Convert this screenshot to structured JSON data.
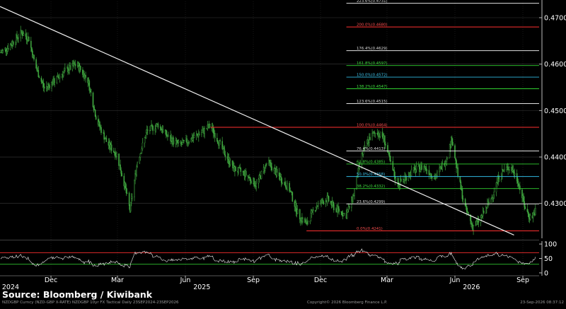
{
  "chart_data": [
    {
      "type": "candlestick",
      "ylim": [
        0.4225,
        0.4735
      ],
      "ytick_labels": [
        "0.4700",
        "0.4600",
        "0.4500",
        "0.4400",
        "0.4300"
      ],
      "ytick_values": [
        0.47,
        0.46,
        0.45,
        0.44,
        0.43
      ],
      "xlim": [
        "2024-09-23",
        "2026-09-23"
      ],
      "x_month_labels": [
        {
          "label": "Dec",
          "date": "2024-12-01"
        },
        {
          "label": "Mar",
          "date": "2025-03-01"
        },
        {
          "label": "Jun",
          "date": "2025-06-01"
        },
        {
          "label": "Sep",
          "date": "2025-09-01"
        },
        {
          "label": "Dec",
          "date": "2025-12-01"
        },
        {
          "label": "Mar",
          "date": "2026-03-01"
        },
        {
          "label": "Jun",
          "date": "2026-06-01"
        },
        {
          "label": "Sep",
          "date": "2026-09-01"
        }
      ],
      "x_year_labels": [
        {
          "label": "2024",
          "date": "2024-10-15"
        },
        {
          "label": "2025",
          "date": "2025-07-01"
        },
        {
          "label": "2026",
          "date": "2026-07-01"
        }
      ],
      "price_path": [
        [
          "2024-09-24",
          0.4625
        ],
        [
          "2024-10-05",
          0.4638
        ],
        [
          "2024-10-15",
          0.4655
        ],
        [
          "2024-10-22",
          0.4668
        ],
        [
          "2024-11-01",
          0.4655
        ],
        [
          "2024-11-10",
          0.4595
        ],
        [
          "2024-11-22",
          0.4548
        ],
        [
          "2024-12-05",
          0.4562
        ],
        [
          "2024-12-20",
          0.4585
        ],
        [
          "2025-01-05",
          0.46
        ],
        [
          "2025-01-20",
          0.4565
        ],
        [
          "2025-02-01",
          0.448
        ],
        [
          "2025-02-15",
          0.443
        ],
        [
          "2025-02-28",
          0.4405
        ],
        [
          "2025-03-10",
          0.4345
        ],
        [
          "2025-03-18",
          0.4285
        ],
        [
          "2025-03-28",
          0.439
        ],
        [
          "2025-04-10",
          0.4455
        ],
        [
          "2025-04-25",
          0.447
        ],
        [
          "2025-05-10",
          0.444
        ],
        [
          "2025-05-25",
          0.4425
        ],
        [
          "2025-06-10",
          0.444
        ],
        [
          "2025-06-25",
          0.4455
        ],
        [
          "2025-07-05",
          0.4468
        ],
        [
          "2025-07-20",
          0.442
        ],
        [
          "2025-08-05",
          0.4375
        ],
        [
          "2025-08-20",
          0.4365
        ],
        [
          "2025-09-05",
          0.434
        ],
        [
          "2025-09-20",
          0.439
        ],
        [
          "2025-10-05",
          0.436
        ],
        [
          "2025-10-20",
          0.433
        ],
        [
          "2025-11-01",
          0.4275
        ],
        [
          "2025-11-12",
          0.4255
        ],
        [
          "2025-11-25",
          0.4295
        ],
        [
          "2025-12-10",
          0.431
        ],
        [
          "2025-12-20",
          0.429
        ],
        [
          "2026-01-05",
          0.4275
        ],
        [
          "2026-01-15",
          0.432
        ],
        [
          "2026-01-25",
          0.44
        ],
        [
          "2026-02-05",
          0.444
        ],
        [
          "2026-02-15",
          0.4455
        ],
        [
          "2026-02-25",
          0.444
        ],
        [
          "2026-03-05",
          0.439
        ],
        [
          "2026-03-15",
          0.434
        ],
        [
          "2026-03-25",
          0.4355
        ],
        [
          "2026-04-05",
          0.437
        ],
        [
          "2026-04-20",
          0.438
        ],
        [
          "2026-05-05",
          0.4355
        ],
        [
          "2026-05-20",
          0.4395
        ],
        [
          "2026-05-28",
          0.444
        ],
        [
          "2026-06-05",
          0.436
        ],
        [
          "2026-06-15",
          0.429
        ],
        [
          "2026-06-25",
          0.425
        ],
        [
          "2026-07-05",
          0.4265
        ],
        [
          "2026-07-20",
          0.431
        ],
        [
          "2026-08-01",
          0.4365
        ],
        [
          "2026-08-15",
          0.438
        ],
        [
          "2026-08-25",
          0.435
        ],
        [
          "2026-09-05",
          0.4285
        ],
        [
          "2026-09-12",
          0.4268
        ],
        [
          "2026-09-20",
          0.429
        ]
      ],
      "trendline": {
        "start": [
          "2024-09-23",
          0.4724
        ],
        "end": [
          "2026-08-20",
          0.4232
        ]
      },
      "fibonacci_base": {
        "start": "2025-07-05",
        "end": "2026-09-23"
      },
      "fibonacci_levels": [
        {
          "label": "0.0%(0.4241)",
          "value": 0.4241,
          "color": "#ff3030",
          "label_color": "#ff5050"
        },
        {
          "label": "23.6%(0.4299)",
          "value": 0.4299,
          "color": "#e0e0e0",
          "label_color": "#d8d8d8"
        },
        {
          "label": "38.2%(0.4332)",
          "value": 0.4332,
          "color": "#30d030",
          "label_color": "#40e040"
        },
        {
          "label": "50.0%(0.4358)",
          "value": 0.4358,
          "color": "#30b8e0",
          "label_color": "#40c8f0"
        },
        {
          "label": "61.8%(0.4385)",
          "value": 0.4385,
          "color": "#30d030",
          "label_color": "#40e040"
        },
        {
          "label": "76.4%(0.4413)",
          "value": 0.4413,
          "color": "#e0e0e0",
          "label_color": "#d8d8d8"
        },
        {
          "label": "100.0%(0.4464)",
          "value": 0.4464,
          "color": "#ff3030",
          "label_color": "#ff5050"
        },
        {
          "label": "123.6%(0.4515)",
          "value": 0.4515,
          "color": "#e0e0e0",
          "label_color": "#d8d8d8"
        },
        {
          "label": "138.2%(0.4547)",
          "value": 0.4547,
          "color": "#30d030",
          "label_color": "#40e040"
        },
        {
          "label": "150.0%(0.4572)",
          "value": 0.4572,
          "color": "#30b8e0",
          "label_color": "#40c8f0"
        },
        {
          "label": "161.8%(0.4597)",
          "value": 0.4597,
          "color": "#30d030",
          "label_color": "#40e040"
        },
        {
          "label": "176.4%(0.4629)",
          "value": 0.4629,
          "color": "#e0e0e0",
          "label_color": "#d8d8d8"
        },
        {
          "label": "200.0%(0.4680)",
          "value": 0.468,
          "color": "#ff3030",
          "label_color": "#ff5050"
        },
        {
          "label": "223.6%(0.4731)",
          "value": 0.4731,
          "color": "#e0e0e0",
          "label_color": "#d8d8d8"
        }
      ]
    },
    {
      "type": "line",
      "ylim": [
        -10,
        110
      ],
      "ytick_labels": [
        "100",
        "50",
        "0"
      ],
      "ytick_values": [
        100,
        50,
        0
      ],
      "reference_lines": [
        {
          "value": 70,
          "color": "#ff3030"
        },
        {
          "value": 30,
          "color": "#30c030"
        }
      ],
      "series_color": "#f0f0f0"
    }
  ],
  "source_text": "Source: Bloomberg / Kiwibank",
  "footer": {
    "left": "NZDGBP Curncy (NZD-GBP X-RATE) NZDGBP 10yr FX Tactical Daily 23SEP2024-23SEP2026",
    "center": "Copyright© 2026 Bloomberg Finance L.P.",
    "right": "23-Sep-2026 08:37:12"
  },
  "colors": {
    "background": "#000000",
    "candles": "#3fa53f",
    "grid": "#3a3a3a",
    "trendline": "#f0f0f0",
    "axis_text": "#ffffff"
  }
}
